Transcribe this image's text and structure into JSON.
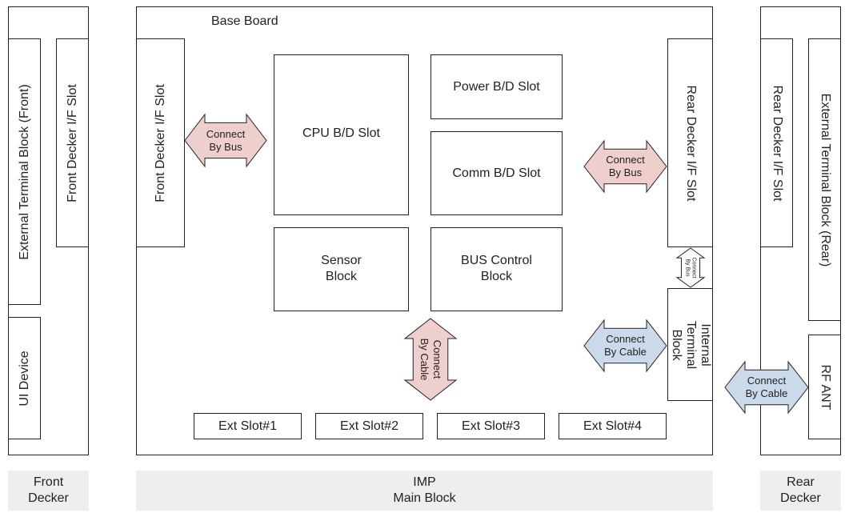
{
  "front_decker": {
    "external_terminal_block": "External Terminal Block (Front)",
    "front_decker_if_slot": "Front Decker I/F Slot",
    "ui_device": "UI Device",
    "caption": "Front\nDecker"
  },
  "main_block": {
    "title": "Base Board",
    "front_decker_if_slot": "Front Decker I/F Slot",
    "cpu": "CPU B/D Slot",
    "power": "Power B/D Slot",
    "comm": "Comm B/D Slot",
    "sensor": "Sensor\nBlock",
    "bus_control": "BUS Control\nBlock",
    "rear_decker_if_slot": "Rear Decker I/F Slot",
    "internal_terminal_block": "Internal\nTerminal Block",
    "ext_slots": [
      "Ext Slot#1",
      "Ext Slot#2",
      "Ext Slot#3",
      "Ext Slot#4"
    ],
    "caption": "IMP\nMain Block"
  },
  "arrows": {
    "front_bus": "Connect\nBy Bus",
    "rear_bus": "Connect\nBy Bus",
    "internal_cable": "Connect\nBy Cable",
    "vertical_cable": "Connect\nBy Cable",
    "small_bus": "Connect\nBy Bus",
    "rf_cable": "Connect\nBy Cable"
  },
  "rear_decker": {
    "rear_decker_if_slot": "Rear Decker I/F Slot",
    "external_terminal_block": "External Terminal Block (Rear)",
    "rf_ant": "RF ANT",
    "caption": "Rear\nDecker"
  },
  "colors": {
    "bus_arrow": "#efcfcd",
    "cable_arrow": "#cbdaea",
    "caption_bg": "#eeeeee"
  }
}
